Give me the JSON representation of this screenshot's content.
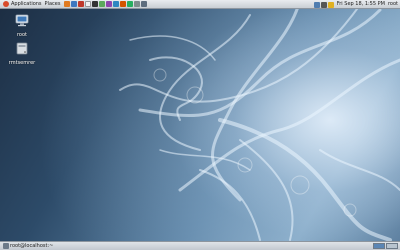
{
  "top_panel": {
    "menu_labels": [
      "Applications",
      "Places"
    ],
    "launcher_icons": [
      "firefox-icon",
      "mail-icon",
      "calendar-icon",
      "document-icon",
      "terminal-icon",
      "text-editor-icon",
      "image-icon",
      "chat-icon",
      "music-icon",
      "spreadsheet-icon",
      "settings-icon",
      "people-icon"
    ],
    "tray_icons": [
      "network-icon",
      "volume-icon",
      "notification-icon"
    ],
    "clock": "Fri Sep 18, 1:55 PM",
    "user": "root"
  },
  "desktop": {
    "icons": [
      {
        "label": "root",
        "icon": "computer-icon"
      },
      {
        "label": "rmtsemrer",
        "icon": "drive-icon"
      }
    ]
  },
  "bottom_panel": {
    "taskbar_label": "root@localhost:~",
    "workspaces": 2,
    "active_workspace": 1
  },
  "colors": {
    "panel": "#d5dade",
    "desktop_dark": "#1c2d42",
    "desktop_light": "#dbe8f3",
    "accent": "#5b86b5"
  }
}
